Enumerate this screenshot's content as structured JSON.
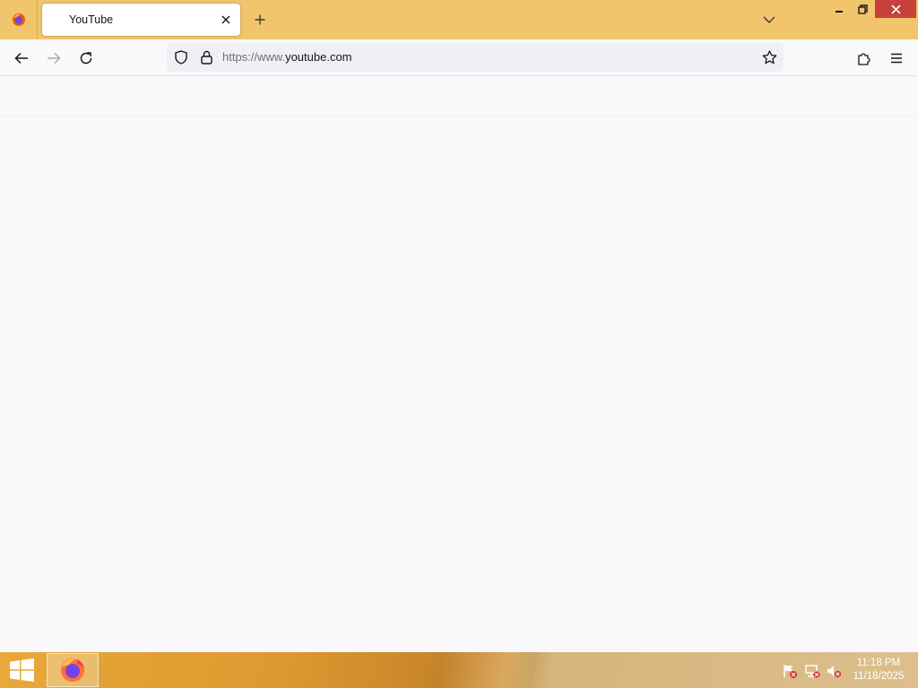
{
  "browser": {
    "tab": {
      "title": "YouTube"
    },
    "url": {
      "protocol": "https://www.",
      "host": "youtube.com"
    }
  },
  "icons": {
    "firefox_menu": "firefox-icon",
    "tab_close": "close-icon",
    "new_tab": "plus-icon",
    "tab_list": "chevron-down-icon",
    "back": "arrow-left-icon",
    "forward": "arrow-right-icon",
    "reload": "reload-icon",
    "tracking": "shield-icon",
    "lock": "lock-icon",
    "bookmark": "star-icon",
    "extensions": "puzzle-icon",
    "menu": "hamburger-icon"
  },
  "colors": {
    "tabstrip": "#f0c56c",
    "close_button": "#c7413a",
    "content_bg": "#f9f9fb"
  },
  "taskbar": {
    "clock": {
      "time": "11:18 PM",
      "date": "11/18/2025"
    }
  }
}
